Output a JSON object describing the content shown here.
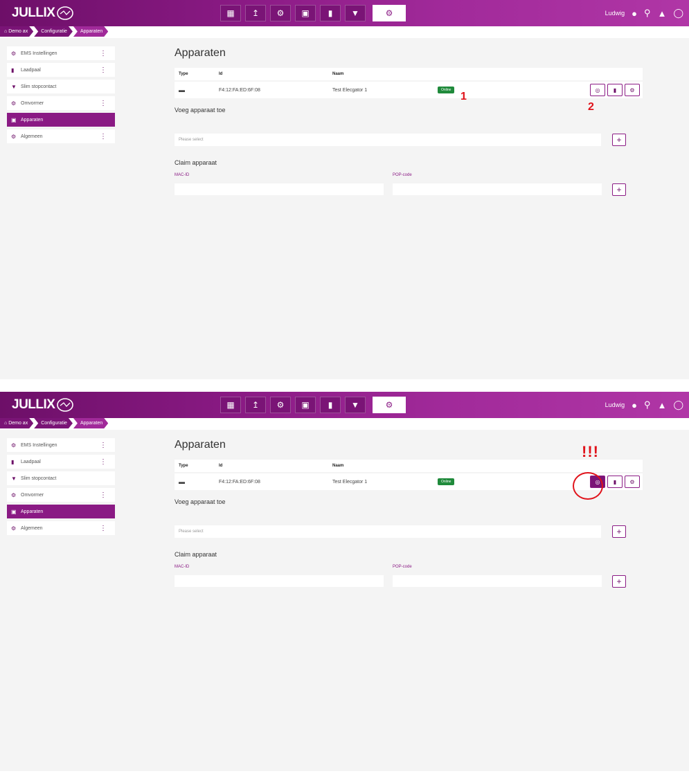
{
  "app": {
    "logo_text": "JULLIX"
  },
  "nav": {
    "icons": [
      "dashboard-icon",
      "chart-icon",
      "brain-icon",
      "battery-icon",
      "charger-icon",
      "plug-icon",
      "gear-icon"
    ],
    "active": "gear-icon"
  },
  "user": {
    "name": "Ludwig"
  },
  "breadcrumb": [
    "Demo ax",
    "Configuratie",
    "Apparaten"
  ],
  "sidebar": {
    "items": [
      {
        "label": "EMS Instellingen",
        "icon": "ems-icon",
        "kebab": true
      },
      {
        "label": "Laadpaal",
        "icon": "charger-icon",
        "kebab": true
      },
      {
        "label": "Slim stopcontact",
        "icon": "plug-icon",
        "kebab": false
      },
      {
        "label": "Omvormer",
        "icon": "gear-icon",
        "kebab": true
      },
      {
        "label": "Apparaten",
        "icon": "devices-icon",
        "kebab": false,
        "active": true
      },
      {
        "label": "Algemeen",
        "icon": "gear-icon",
        "kebab": true
      }
    ]
  },
  "main": {
    "title": "Apparaten",
    "table": {
      "headers": {
        "type": "Type",
        "id": "Id",
        "naam": "Naam"
      },
      "row": {
        "id": "F4:12:FA:ED:6F:08",
        "naam": "Test Elecgator 1",
        "status": "Online"
      }
    },
    "add_device": {
      "label": "Voeg apparaat toe",
      "placeholder": "Please select"
    },
    "claim": {
      "label": "Claim apparaat",
      "mac_label": "MAC-ID",
      "pop_label": "POP-code"
    }
  },
  "annotations": {
    "marker_1": "1",
    "marker_2": "2",
    "marker_3": "!!!"
  },
  "colors": {
    "brand": "#8a1a84",
    "online": "#1f8a3b",
    "annotation": "#e0121a"
  }
}
